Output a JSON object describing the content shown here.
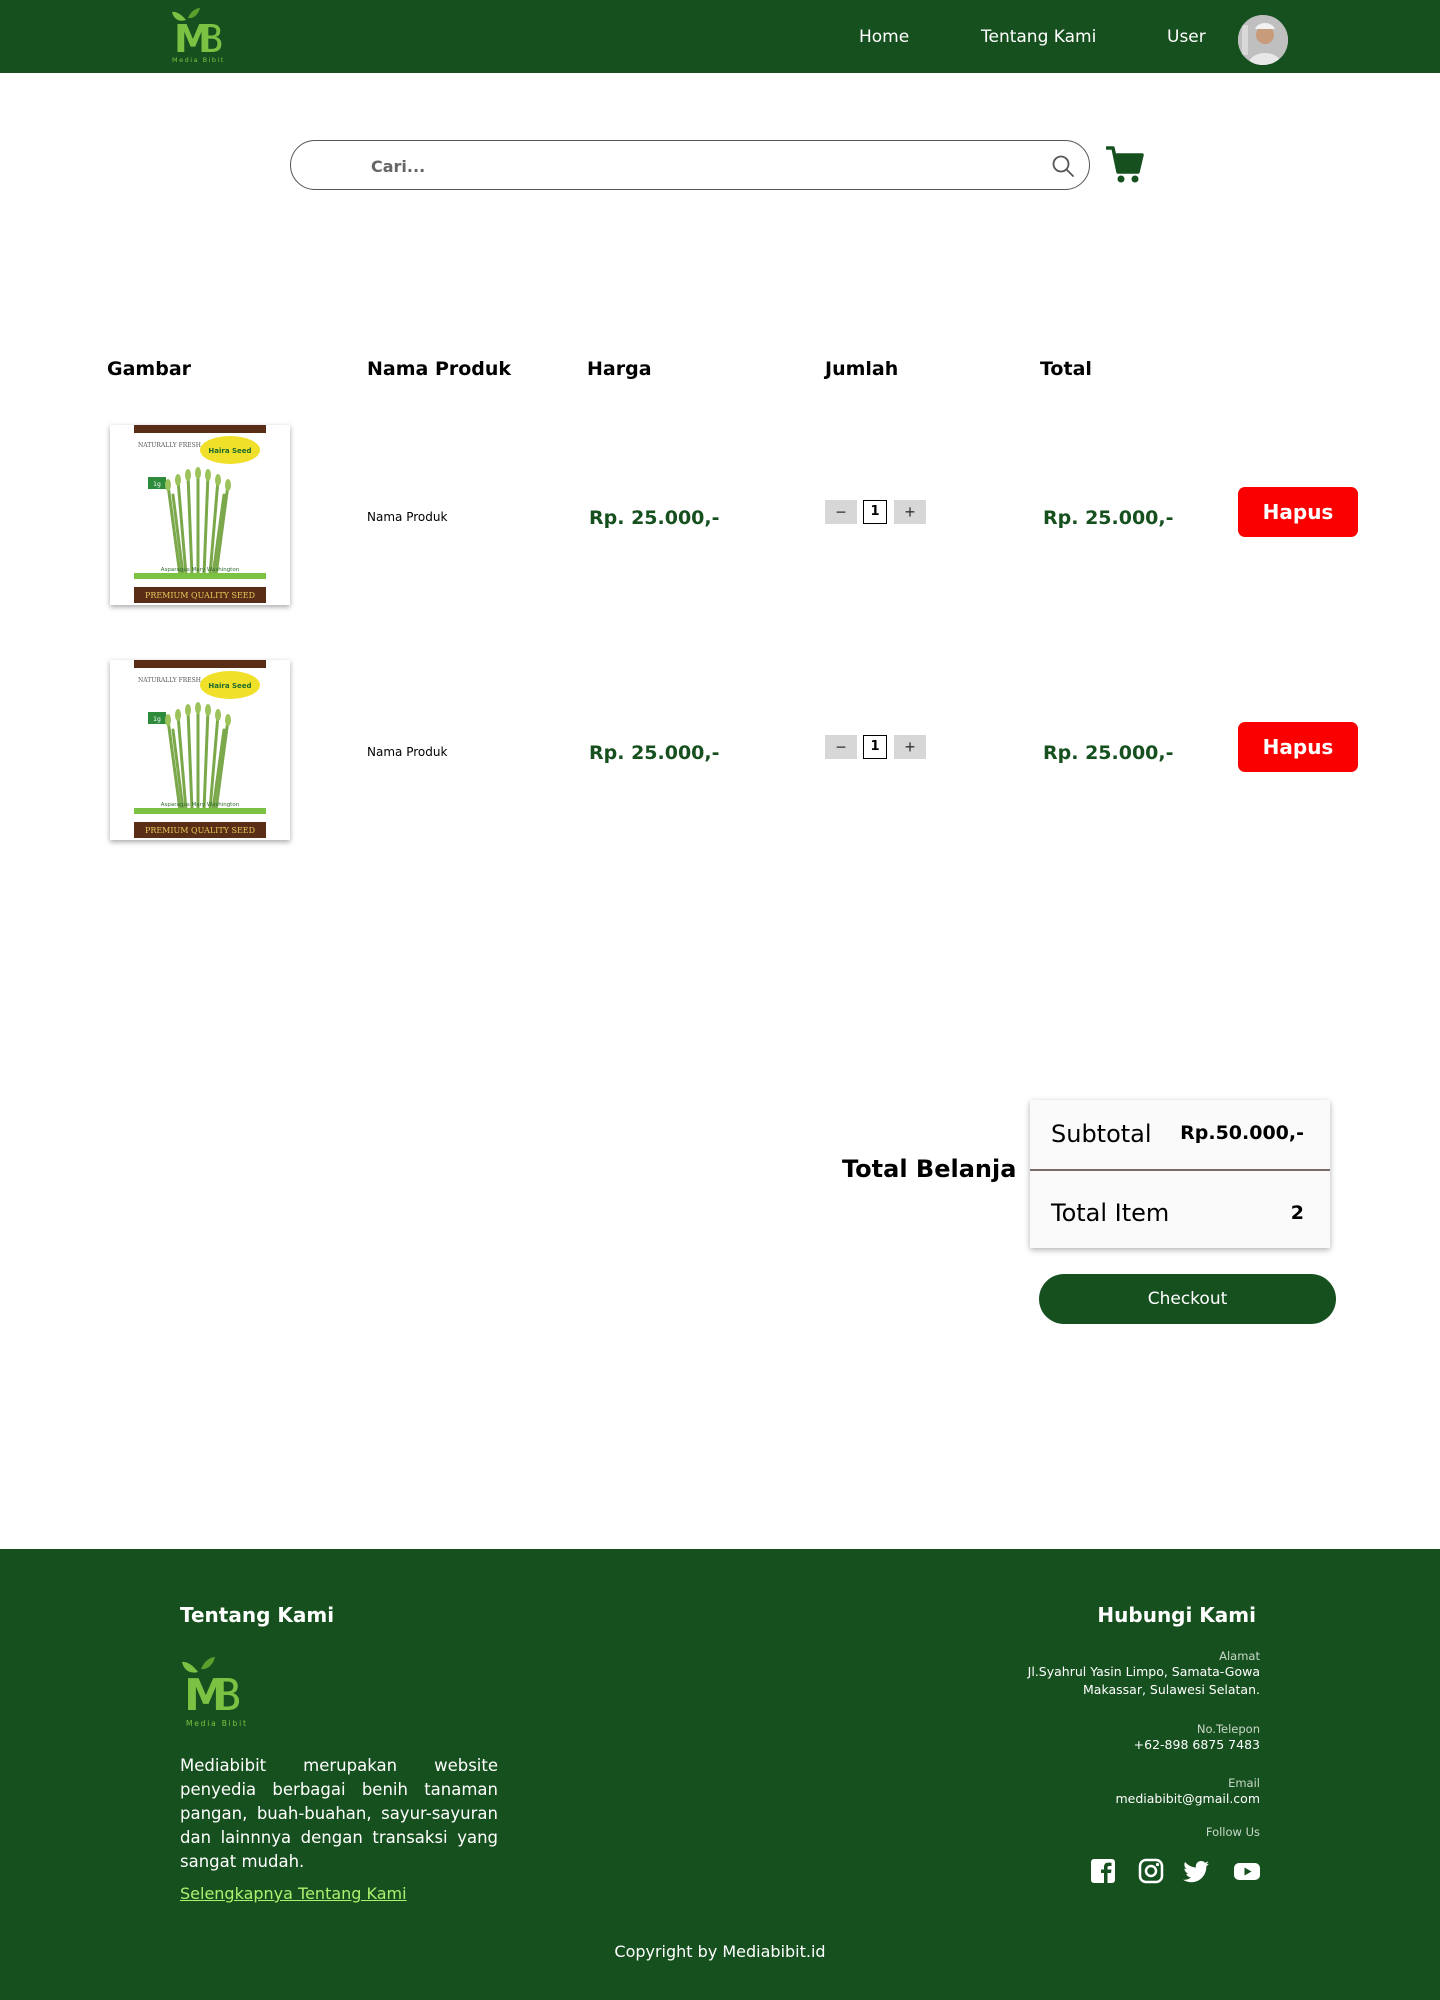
{
  "header": {
    "logo_text": "MB",
    "logo_sub": "Media Bibit",
    "nav": [
      "Home",
      "Tentang Kami",
      "User"
    ]
  },
  "search": {
    "placeholder": "Cari..."
  },
  "table": {
    "headers": [
      "Gambar",
      "Nama Produk",
      "Harga",
      "Jumlah",
      "Total"
    ],
    "rows": [
      {
        "name": "Nama Produk",
        "price": "Rp. 25.000,-",
        "qty": "1",
        "total": "Rp. 25.000,-",
        "delete_label": "Hapus"
      },
      {
        "name": "Nama Produk",
        "price": "Rp. 25.000,-",
        "qty": "1",
        "total": "Rp. 25.000,-",
        "delete_label": "Hapus"
      }
    ],
    "packet": {
      "top_left": "NATURALLY FRESH",
      "brand": "Haira Seed",
      "weight": "1g",
      "variety": "Asparagus Mary Washington",
      "bottom": "PREMIUM QUALITY SEED"
    }
  },
  "summary": {
    "title": "Total Belanja",
    "subtotal_label": "Subtotal",
    "subtotal_value": "Rp.50.000,-",
    "items_label": "Total Item",
    "items_value": "2",
    "checkout_label": "Checkout"
  },
  "footer": {
    "about_title": "Tentang Kami",
    "about_text": "Mediabibit merupakan website penyedia berbagai benih tanaman pangan, buah-buahan, sayur-sayuran dan lainnnya dengan transaksi yang sangat mudah.",
    "more_link": "Selengkapnya Tentang Kami",
    "contact_title": "Hubungi Kami",
    "address_label": "Alamat",
    "address_line1": "Jl.Syahrul Yasin Limpo, Samata-Gowa",
    "address_line2": "Makassar, Sulawesi Selatan.",
    "phone_label": "No.Telepon",
    "phone_value": "+62-898 6875 7483",
    "email_label": "Email",
    "email_value": "mediabibit@gmail.com",
    "follow_label": "Follow Us",
    "copyright": "Copyright by Mediabibit.id"
  },
  "colors": {
    "brand_green": "#17501f",
    "logo_green": "#7cc242",
    "danger_red": "#fb0000",
    "link_green": "#aef06f"
  },
  "icons": [
    "search-icon",
    "cart-icon",
    "facebook-icon",
    "instagram-icon",
    "twitter-icon",
    "youtube-icon"
  ]
}
